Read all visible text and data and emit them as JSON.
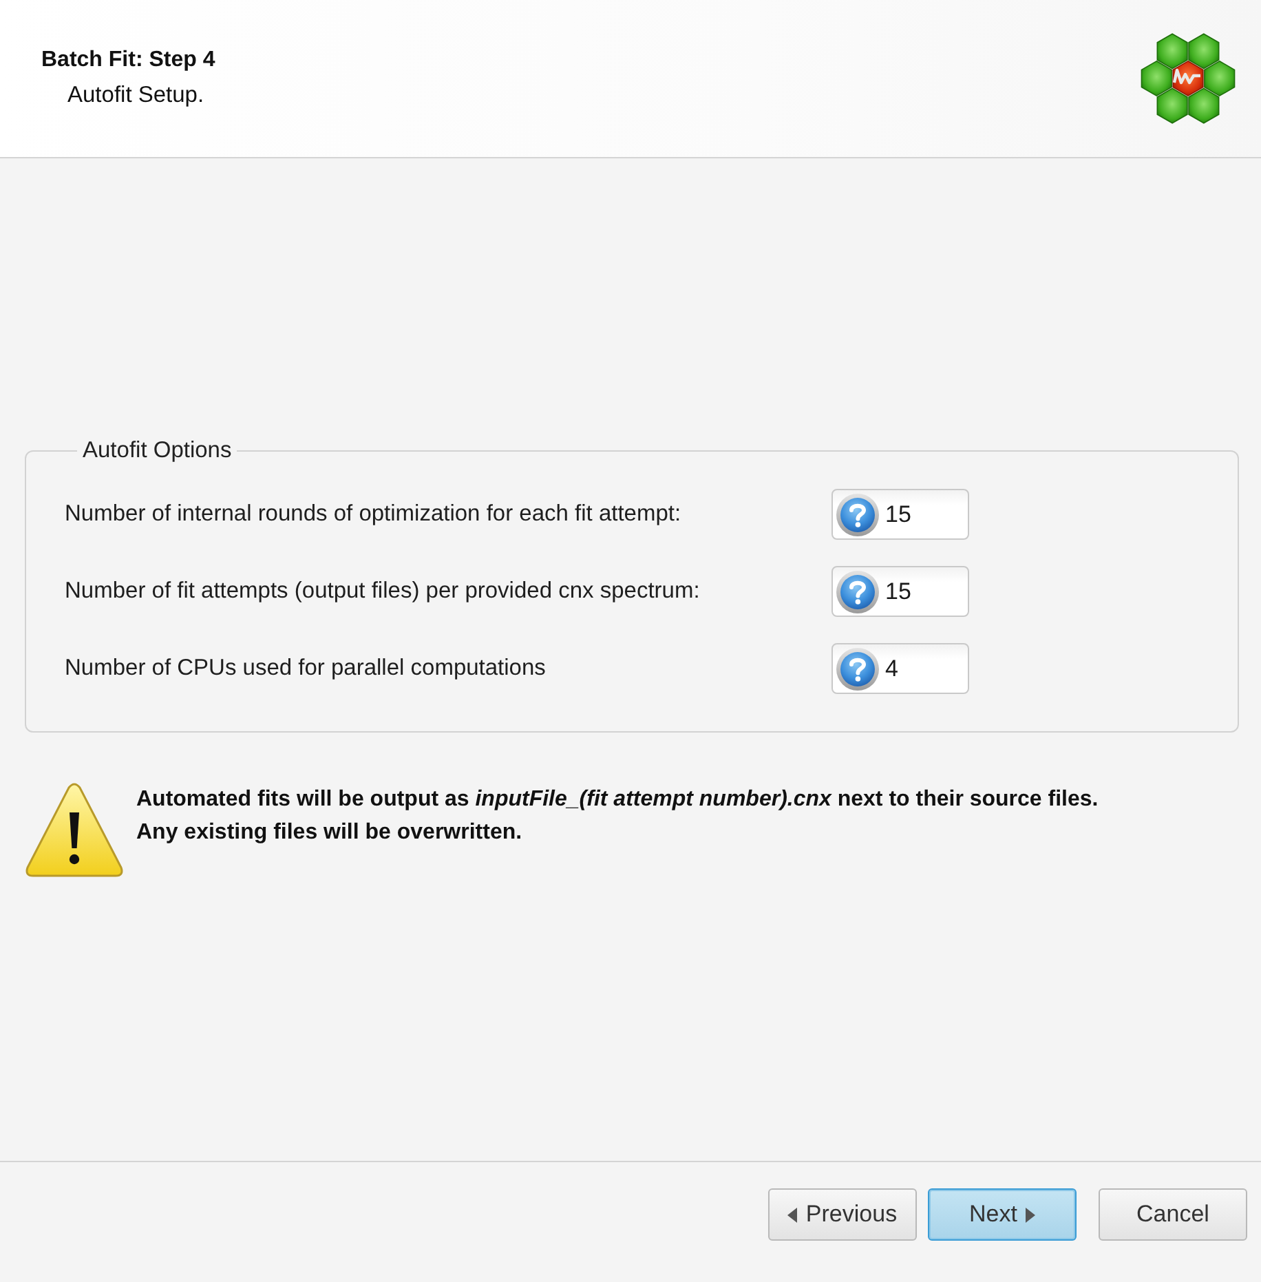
{
  "header": {
    "title": "Batch Fit: Step 4",
    "subtitle": "Autofit Setup."
  },
  "autofit_options": {
    "title": "Autofit Options",
    "fields": [
      {
        "label": "Number of internal rounds of optimization for each fit attempt:",
        "value": "15"
      },
      {
        "label": "Number of fit attempts (output files) per provided cnx spectrum:",
        "value": "15"
      },
      {
        "label": "Number of CPUs used for parallel computations",
        "value": "4"
      }
    ]
  },
  "warning": {
    "lines": [
      "Automated fits will be output as *inputFile_(fit attempt number).cnx* next to their source files.",
      "Any existing files will be overwritten."
    ]
  },
  "buttons": [
    {
      "label": "Previous",
      "kind": "previous",
      "focused": false
    },
    {
      "label": "Next",
      "kind": "next",
      "focused": true
    },
    {
      "label": "Cancel",
      "kind": "cancel",
      "focused": false
    }
  ]
}
